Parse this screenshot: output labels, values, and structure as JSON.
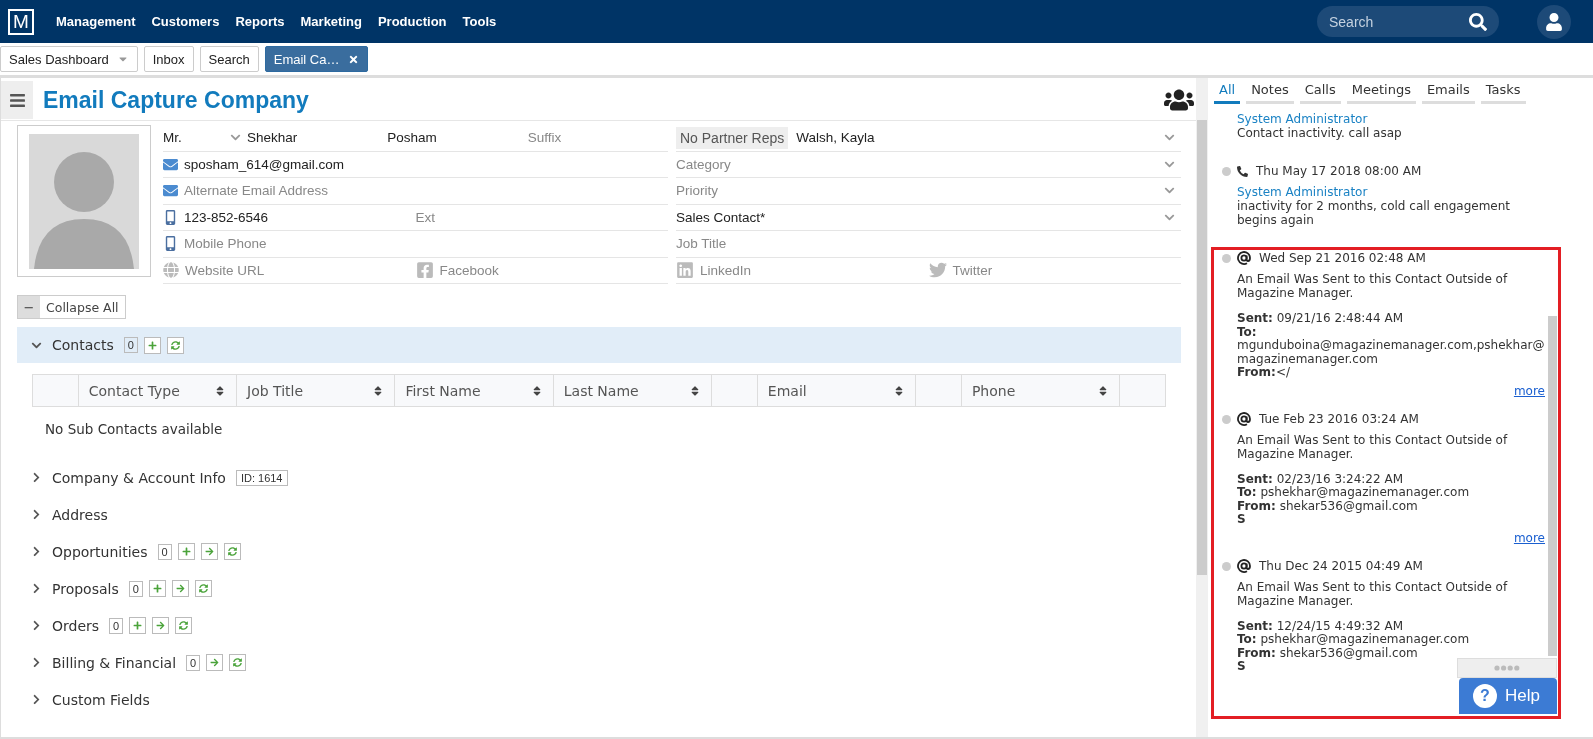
{
  "nav": {
    "logo": "M",
    "menu": [
      "Management",
      "Customers",
      "Reports",
      "Marketing",
      "Production",
      "Tools"
    ],
    "search": {
      "placeholder": "Search"
    }
  },
  "tabs": [
    {
      "label": "Sales Dashboard",
      "kind": "dropdown",
      "selected": false
    },
    {
      "label": "Inbox",
      "kind": "plain",
      "selected": false
    },
    {
      "label": "Search",
      "kind": "plain",
      "selected": false
    },
    {
      "label": "Email Ca…",
      "kind": "closable",
      "selected": true
    }
  ],
  "record": {
    "title": "Email Capture Company",
    "rows": [
      {
        "left": [
          {
            "kind": "select",
            "value": "Mr."
          },
          {
            "kind": "text",
            "value": "Shekhar"
          },
          {
            "kind": "text",
            "value": "Posham"
          },
          {
            "kind": "text",
            "placeholder": "Suffix"
          }
        ],
        "right": [
          {
            "kind": "button",
            "value": "No Partner Reps"
          },
          {
            "kind": "select",
            "value": "Walsh, Kayla"
          }
        ]
      },
      {
        "left": [
          {
            "kind": "email",
            "value": "sposham_614@gmail.com"
          }
        ],
        "right": [
          {
            "kind": "select",
            "placeholder": "Category"
          }
        ]
      },
      {
        "left": [
          {
            "kind": "email",
            "placeholder": "Alternate Email Address"
          }
        ],
        "right": [
          {
            "kind": "select",
            "placeholder": "Priority"
          }
        ]
      },
      {
        "left": [
          {
            "kind": "phone",
            "value": "123-852-6546"
          },
          {
            "kind": "text",
            "placeholder": "Ext"
          }
        ],
        "right": [
          {
            "kind": "select",
            "value": "Sales Contact*"
          }
        ]
      },
      {
        "left": [
          {
            "kind": "phone",
            "placeholder": "Mobile Phone"
          }
        ],
        "right": [
          {
            "kind": "text",
            "placeholder": "Job Title"
          }
        ]
      },
      {
        "left": [
          {
            "kind": "website",
            "placeholder": "Website URL"
          },
          {
            "kind": "facebook",
            "placeholder": "Facebook"
          }
        ],
        "right": [
          {
            "kind": "linkedin",
            "placeholder": "LinkedIn"
          },
          {
            "kind": "twitter",
            "placeholder": "Twitter"
          }
        ]
      }
    ],
    "collapse_all": {
      "icon": "−",
      "label": "Collapse All"
    },
    "sections": [
      {
        "label": "Contacts",
        "expanded": true,
        "count": "0",
        "actions": [
          {
            "kind": "add"
          },
          {
            "kind": "refresh"
          }
        ],
        "table": {
          "columns": [
            "",
            "Contact Type",
            "Job Title",
            "First Name",
            "Last Name",
            "",
            "Email",
            "",
            "Phone",
            ""
          ],
          "empty": "No Sub Contacts available"
        }
      },
      {
        "label": "Company & Account Info",
        "expanded": false,
        "badge": "ID: 1614"
      },
      {
        "label": "Address",
        "expanded": false
      },
      {
        "label": "Opportunities",
        "expanded": false,
        "count": "0",
        "actions": [
          {
            "kind": "add"
          },
          {
            "kind": "forward"
          },
          {
            "kind": "refresh"
          }
        ]
      },
      {
        "label": "Proposals",
        "expanded": false,
        "count": "0",
        "actions": [
          {
            "kind": "add"
          },
          {
            "kind": "forward"
          },
          {
            "kind": "refresh"
          }
        ]
      },
      {
        "label": "Orders",
        "expanded": false,
        "count": "0",
        "actions": [
          {
            "kind": "add"
          },
          {
            "kind": "forward"
          },
          {
            "kind": "refresh"
          }
        ]
      },
      {
        "label": "Billing & Financial",
        "expanded": false,
        "count": "0",
        "actions": [
          {
            "kind": "forward"
          },
          {
            "kind": "refresh"
          }
        ]
      },
      {
        "label": "Custom Fields",
        "expanded": false
      }
    ]
  },
  "activity": {
    "tabs": [
      {
        "label": "All",
        "selected": true
      },
      {
        "label": "Notes",
        "selected": false
      },
      {
        "label": "Calls",
        "selected": false
      },
      {
        "label": "Meetings",
        "selected": false
      },
      {
        "label": "Emails",
        "selected": false
      },
      {
        "label": "Tasks",
        "selected": false
      }
    ],
    "entries": [
      {
        "author": "System Administrator",
        "text": "Contact inactivity. call asap"
      },
      {
        "kind": "call",
        "date": "Thu May 17 2018 08:00 AM",
        "author": "System Administrator",
        "text": "inactivity for 2 months, cold call engagement begins again"
      },
      {
        "kind": "email",
        "date": "Wed Sep 21 2016 02:48 AM",
        "text": "An Email Was Sent to this Contact Outside of Magazine Manager.",
        "lines": [
          "**Sent:** 09/21/16 2:48:44 AM",
          "**To:**",
          "mgunduboina@magazinemanager.com,pshekhar@magazinemanager.com",
          "**From:**</"
        ],
        "more": "more"
      },
      {
        "kind": "email",
        "date": "Tue Feb 23 2016 03:24 AM",
        "text": "An Email Was Sent to this Contact Outside of Magazine Manager.",
        "lines": [
          "**Sent:** 02/23/16 3:24:22 AM",
          "**To:** pshekhar@magazinemanager.com",
          "**From:** shekar536@gmail.com",
          "**S**"
        ],
        "more": "more"
      },
      {
        "kind": "email",
        "date": "Thu Dec 24 2015 04:49 AM",
        "text": "An Email Was Sent to this Contact Outside of Magazine Manager.",
        "lines": [
          "**Sent:** 12/24/15 4:49:32 AM",
          "**To:** pshekhar@magazinemanager.com",
          "**From:** shekar536@gmail.com",
          "**S**"
        ]
      }
    ]
  },
  "help": {
    "label": "Help",
    "icon": "?"
  }
}
